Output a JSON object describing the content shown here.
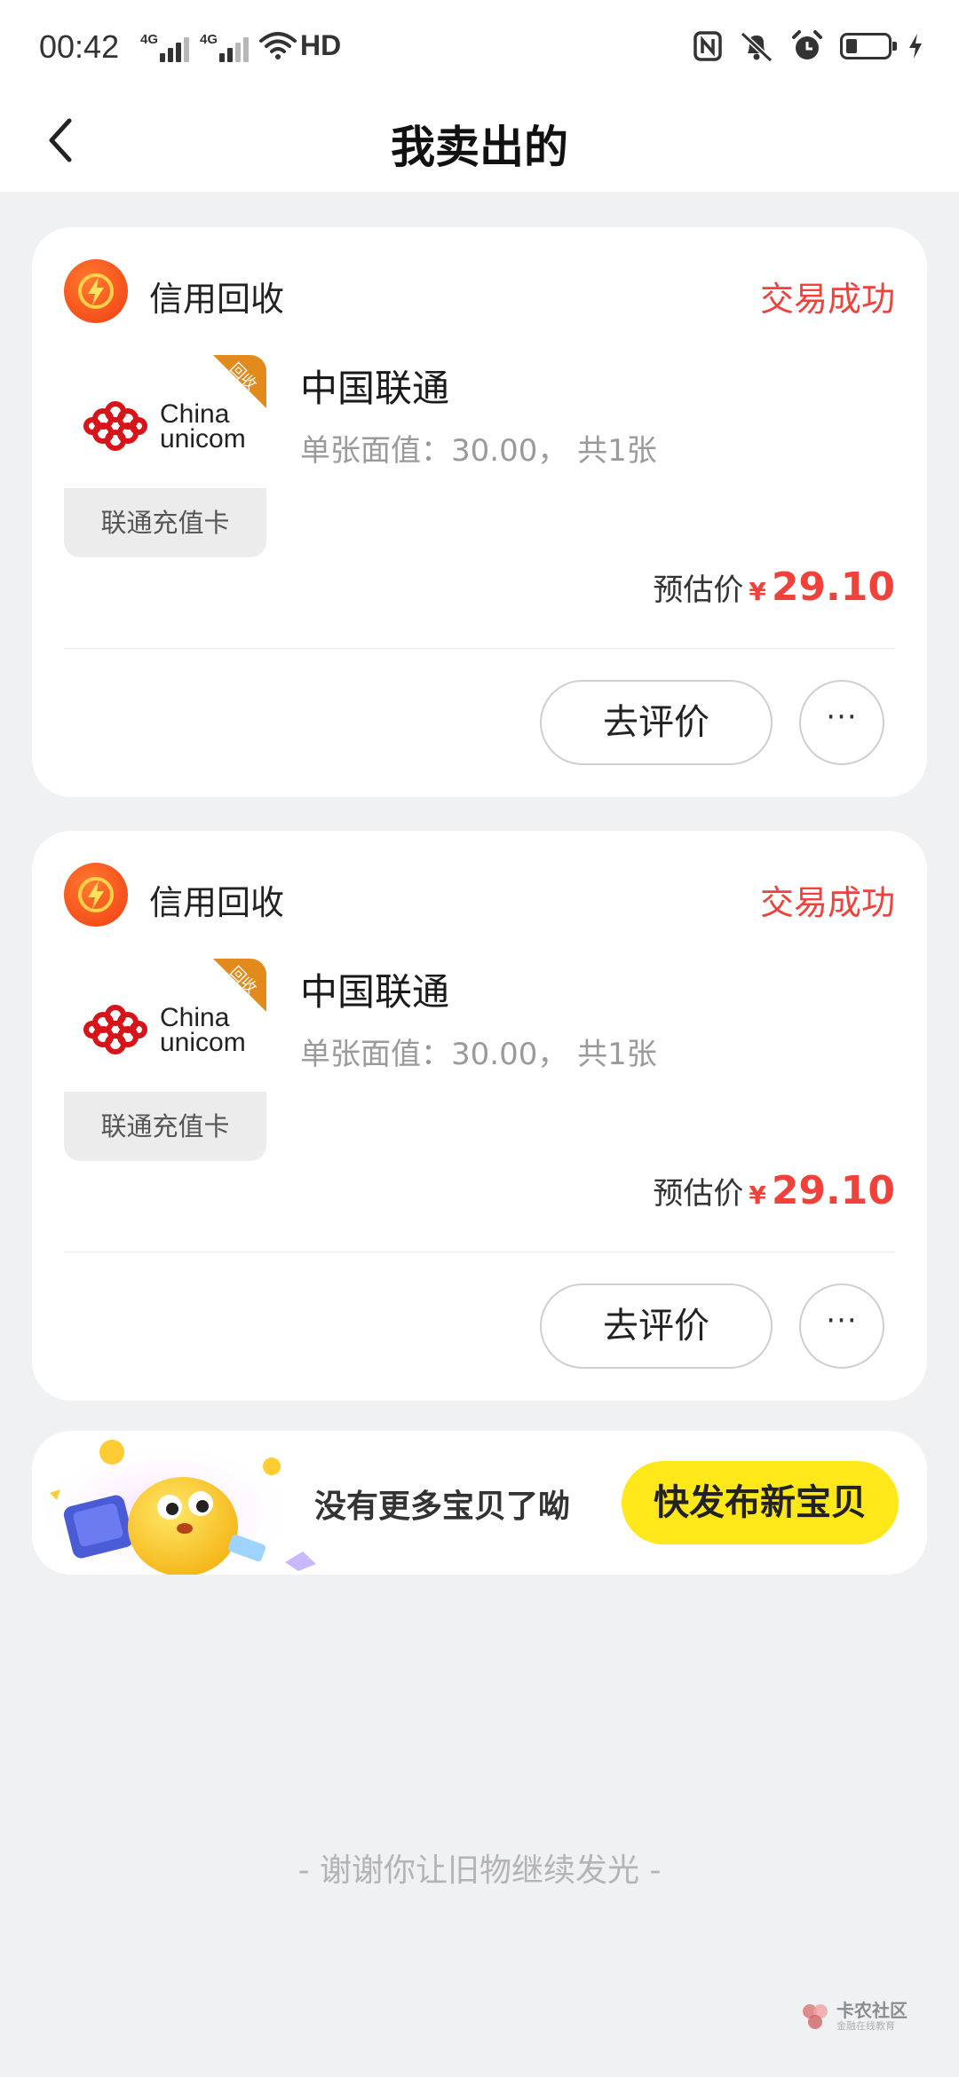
{
  "status_bar": {
    "time": "00:42",
    "network_labels": [
      "4G",
      "4G"
    ],
    "hd_label": "HD"
  },
  "header": {
    "title": "我卖出的"
  },
  "orders": [
    {
      "shop_name": "信用回收",
      "status": "交易成功",
      "badge": "回收",
      "brand_text": [
        "China",
        "unicom"
      ],
      "card_label": "联通充值卡",
      "title": "中国联通",
      "desc": "单张面值：30.00， 共1张",
      "price_label": "预估价",
      "currency": "¥",
      "price": "29.10",
      "review_button": "去评价",
      "more_button": "···"
    },
    {
      "shop_name": "信用回收",
      "status": "交易成功",
      "badge": "回收",
      "brand_text": [
        "China",
        "unicom"
      ],
      "card_label": "联通充值卡",
      "title": "中国联通",
      "desc": "单张面值：30.00， 共1张",
      "price_label": "预估价",
      "currency": "¥",
      "price": "29.10",
      "review_button": "去评价",
      "more_button": "···"
    }
  ],
  "promo": {
    "text": "没有更多宝贝了呦",
    "button": "快发布新宝贝"
  },
  "footer": {
    "note": "- 谢谢你让旧物继续发光 -"
  },
  "watermark": {
    "main": "卡农社区",
    "sub": "金融在线教育"
  },
  "colors": {
    "accent_red": "#f0413a",
    "promo_yellow": "#ffe81a",
    "page_bg": "#f0f1f3"
  }
}
